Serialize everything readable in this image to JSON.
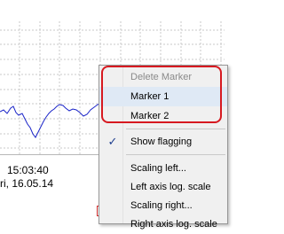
{
  "plot": {
    "time_label": "15:03:40",
    "date_label": "ri, 16.05.14",
    "line_color": "#1a24c8",
    "grid_color": "#c8c8c8"
  },
  "context_menu": {
    "highlight_color": "#d71920",
    "items": [
      {
        "label": "Delete Marker",
        "disabled": true
      },
      {
        "label": "Marker 1",
        "hover": true
      },
      {
        "label": "Marker 2"
      },
      {
        "label": "Show flagging",
        "checked": true,
        "check_icon": "✓"
      },
      {
        "label": "Scaling left..."
      },
      {
        "label": "Left axis log. scale"
      },
      {
        "label": "Scaling right..."
      },
      {
        "label": "Right axis log. scale"
      }
    ]
  }
}
